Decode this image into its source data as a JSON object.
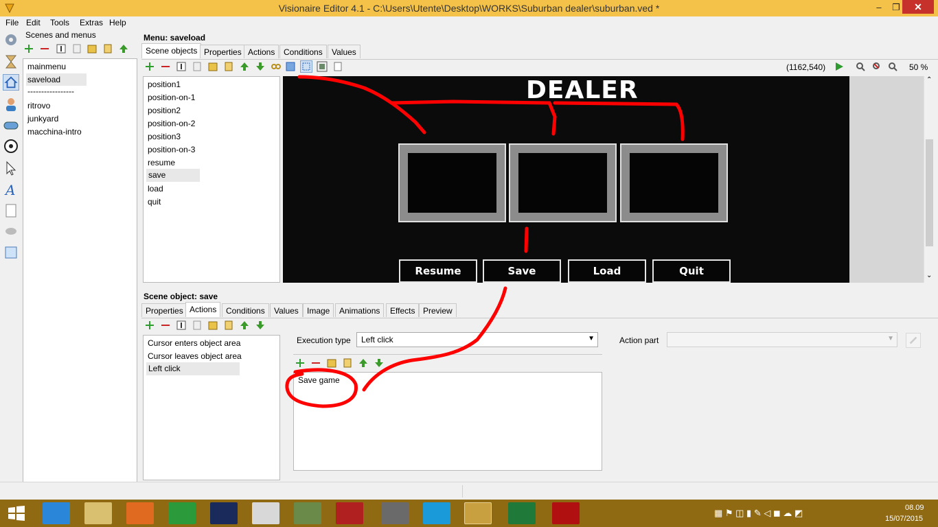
{
  "window": {
    "title": "Visionaire Editor 4.1 - C:\\Users\\Utente\\Desktop\\WORKS\\Suburban dealer\\suburban.ved *",
    "minimize": "–",
    "maximize": "❐",
    "close": "✕"
  },
  "menu": [
    "File",
    "Edit",
    "Tools",
    "Extras",
    "Help"
  ],
  "left_panel": {
    "title": "Scenes and menus",
    "items": [
      "mainmenu",
      "saveload",
      "-----------------",
      "ritrovo",
      "junkyard",
      "macchina-intro"
    ],
    "selected": "saveload"
  },
  "menu_panel": {
    "title": "Menu: saveload",
    "tabs": [
      "Scene objects",
      "Properties",
      "Actions",
      "Conditions",
      "Values"
    ],
    "active_tab": "Scene objects",
    "objects": [
      "position1",
      "position-on-1",
      "position2",
      "position-on-2",
      "position3",
      "position-on-3",
      "resume",
      "save",
      "load",
      "quit"
    ],
    "selected": "save",
    "coords": "(1162,540)",
    "zoom": "50 %"
  },
  "scene": {
    "logo": "DEALER",
    "buttons": [
      "Resume",
      "Save",
      "Load",
      "Quit"
    ]
  },
  "object_panel": {
    "title": "Scene object: save",
    "tabs": [
      "Properties",
      "Actions",
      "Conditions",
      "Values",
      "Image",
      "Animations",
      "Effects",
      "Preview"
    ],
    "active_tab": "Actions",
    "events": [
      "Cursor enters object area",
      "Cursor leaves object area",
      "Left click"
    ],
    "selected": "Left click",
    "execution_type_label": "Execution type",
    "execution_type": "Left click",
    "action_part_label": "Action part",
    "action_part": "",
    "actions": [
      "Save game"
    ]
  },
  "taskbar": {
    "time": "08.09",
    "date": "15/07/2015"
  }
}
